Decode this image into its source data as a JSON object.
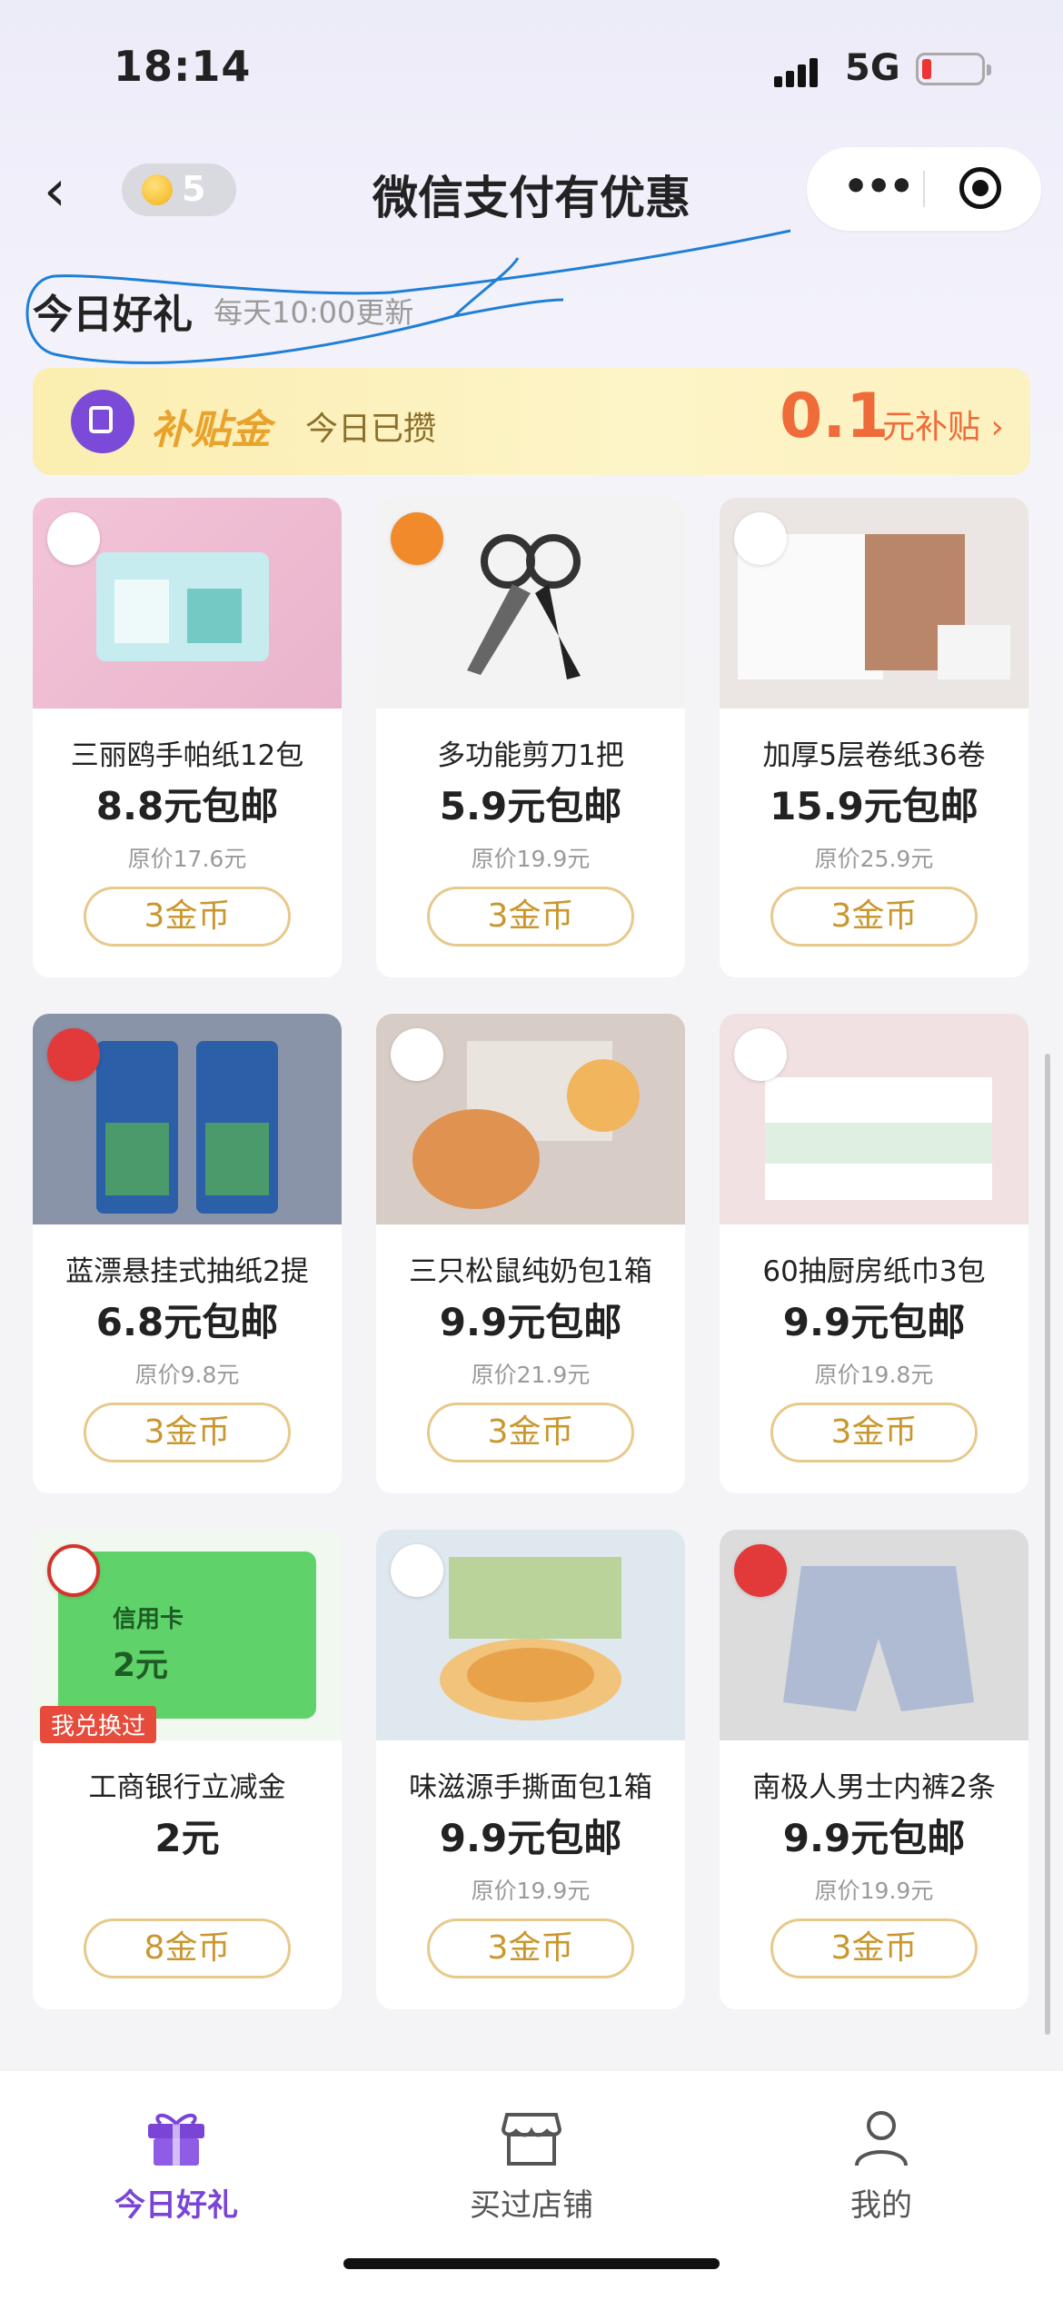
{
  "status_bar": {
    "time": "18:14",
    "network": "5G"
  },
  "nav": {
    "coins": "5",
    "title": "微信支付有优惠"
  },
  "section": {
    "title": "今日好礼",
    "subtitle": "每天10:00更新"
  },
  "banner": {
    "brand": "补贴金",
    "label": "今日已攒",
    "amount": "0.1",
    "unit": "元补贴 ›"
  },
  "products": [
    {
      "name": "三丽鸥手帕纸12包",
      "price": "8.8元包邮",
      "orig": "原价17.6元",
      "cost": "3金币"
    },
    {
      "name": "多功能剪刀1把",
      "price": "5.9元包邮",
      "orig": "原价19.9元",
      "cost": "3金币"
    },
    {
      "name": "加厚5层卷纸36卷",
      "price": "15.9元包邮",
      "orig": "原价25.9元",
      "cost": "3金币"
    },
    {
      "name": "蓝漂悬挂式抽纸2提",
      "price": "6.8元包邮",
      "orig": "原价9.8元",
      "cost": "3金币"
    },
    {
      "name": "三只松鼠纯奶包1箱",
      "price": "9.9元包邮",
      "orig": "原价21.9元",
      "cost": "3金币"
    },
    {
      "name": "60抽厨房纸巾3包",
      "price": "9.9元包邮",
      "orig": "原价19.8元",
      "cost": "3金币"
    },
    {
      "name": "工商银行立减金",
      "price": "2元",
      "orig": "",
      "cost": "8金币",
      "card_label": "信用卡",
      "card_value": "2元",
      "tag": "我兑换过"
    },
    {
      "name": "味滋源手撕面包1箱",
      "price": "9.9元包邮",
      "orig": "原价19.9元",
      "cost": "3金币"
    },
    {
      "name": "南极人男士内裤2条",
      "price": "9.9元包邮",
      "orig": "原价19.9元",
      "cost": "3金币"
    }
  ],
  "tabs": [
    {
      "label": "今日好礼",
      "icon": "gift-icon",
      "active": true
    },
    {
      "label": "买过店铺",
      "icon": "shop-icon",
      "active": false
    },
    {
      "label": "我的",
      "icon": "user-icon",
      "active": false
    }
  ],
  "colors": {
    "accent": "#7a45d6",
    "price_orange": "#ef6b3a",
    "coin_gold": "#c9972e",
    "annotation_blue": "#1f7fd6"
  }
}
